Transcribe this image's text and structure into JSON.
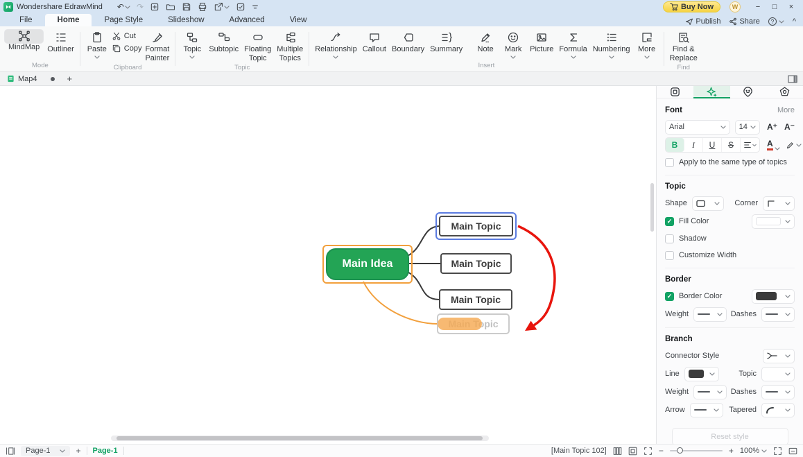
{
  "titlebar": {
    "app_title": "Wondershare EdrawMind",
    "buy_now_label": "Buy Now",
    "avatar_letter": "W"
  },
  "menubar": {
    "tabs": {
      "file": "File",
      "home": "Home",
      "page_style": "Page Style",
      "slideshow": "Slideshow",
      "advanced": "Advanced",
      "view": "View"
    },
    "publish_label": "Publish",
    "share_label": "Share"
  },
  "ribbon": {
    "groups": {
      "mode": {
        "label": "Mode",
        "mindmap": "MindMap",
        "outliner": "Outliner"
      },
      "clipboard": {
        "label": "Clipboard",
        "paste": "Paste",
        "cut": "Cut",
        "copy": "Copy",
        "format_painter": "Format\nPainter"
      },
      "topic": {
        "label": "Topic",
        "topic": "Topic",
        "subtopic": "Subtopic",
        "floating_topic": "Floating\nTopic",
        "multiple_topics": "Multiple\nTopics"
      },
      "insert": {
        "label": "Insert",
        "relationship": "Relationship",
        "callout": "Callout",
        "boundary": "Boundary",
        "summary": "Summary",
        "note": "Note",
        "mark": "Mark",
        "picture": "Picture",
        "formula": "Formula",
        "numbering": "Numbering",
        "more": "More"
      },
      "find": {
        "label": "Find",
        "find_replace": "Find &\nReplace"
      }
    }
  },
  "doctabs": {
    "title": "Map4"
  },
  "canvas": {
    "main_idea_label": "Main Idea",
    "topic_labels": [
      "Main Topic",
      "Main Topic",
      "Main Topic",
      "Main Topic"
    ],
    "colors": {
      "main_idea_fill": "#23a455",
      "selection_orange": "#f2a03d",
      "selection_blue": "#5b7be0",
      "branch_black": "#3a3a3a",
      "branch_orange": "#f2a03d",
      "relationship_red": "#e8150d",
      "drag_pill": "#f5a74f"
    }
  },
  "sidepanel": {
    "font_section": {
      "title": "Font",
      "more_label": "More",
      "font_family": "Arial",
      "font_size": "14",
      "increase_label": "A⁺",
      "decrease_label": "A⁻",
      "bold_label": "B",
      "italic_label": "I",
      "underline_label": "U",
      "strike_label": "S",
      "font_color_letter": "A"
    },
    "apply_checkbox_label": "Apply to the same type of topics",
    "topic_section": {
      "title": "Topic",
      "shape_label": "Shape",
      "corner_label": "Corner",
      "fill_color_label": "Fill Color",
      "fill_color_value": "#ffffff",
      "shadow_label": "Shadow",
      "customize_width_label": "Customize Width"
    },
    "border_section": {
      "title": "Border",
      "border_color_label": "Border Color",
      "border_color_value": "#3b3b3b",
      "weight_label": "Weight",
      "dashes_label": "Dashes"
    },
    "branch_section": {
      "title": "Branch",
      "connector_style_label": "Connector Style",
      "line_label": "Line",
      "line_color_value": "#3b3b3b",
      "topic_label": "Topic",
      "weight_label": "Weight",
      "dashes_label": "Dashes",
      "arrow_label": "Arrow",
      "tapered_label": "Tapered"
    },
    "reset_button_label": "Reset style"
  },
  "statusbar": {
    "page_select_value": "Page-1",
    "active_page_tab": "Page-1",
    "selection_info": "[Main Topic 102]",
    "zoom_value": "100%"
  },
  "icons": {
    "undo": "↶",
    "redo": "↷",
    "minimize": "−",
    "maximize": "□",
    "close": "×",
    "help": "?",
    "collapse_ribbon": "^",
    "plus": "+",
    "minus": "−"
  },
  "theme": {
    "accent_green": "#12a264",
    "titlebar_blue": "#d6e4f3",
    "buy_now_yellow": "#f6d343",
    "ribbon_bg": "#f8f9f9"
  }
}
